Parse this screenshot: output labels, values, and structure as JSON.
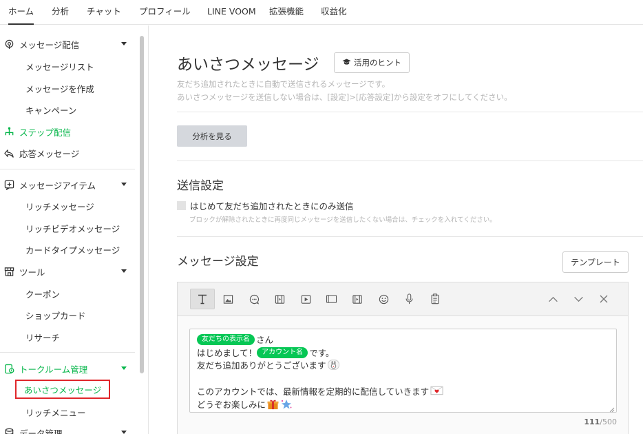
{
  "topnav": {
    "tabs": [
      {
        "label": "ホーム",
        "active": true
      },
      {
        "label": "分析",
        "active": false
      },
      {
        "label": "チャット",
        "active": false
      },
      {
        "label": "プロフィール",
        "active": false
      },
      {
        "label": "LINE VOOM",
        "active": false
      },
      {
        "label": "拡張機能",
        "active": false
      },
      {
        "label": "収益化",
        "active": false
      }
    ]
  },
  "sidebar": {
    "message_delivery": {
      "label": "メッセージ配信",
      "icon": "broadcast-icon"
    },
    "message_list": {
      "label": "メッセージリスト"
    },
    "create_message": {
      "label": "メッセージを作成"
    },
    "campaign": {
      "label": "キャンペーン"
    },
    "step_delivery": {
      "label": "ステップ配信",
      "icon": "step-flow-icon"
    },
    "auto_reply": {
      "label": "応答メッセージ",
      "icon": "reply-arrow-icon"
    },
    "message_items": {
      "label": "メッセージアイテム",
      "icon": "message-item-icon"
    },
    "rich_message": {
      "label": "リッチメッセージ"
    },
    "rich_video_message": {
      "label": "リッチビデオメッセージ"
    },
    "card_message": {
      "label": "カードタイプメッセージ"
    },
    "tools": {
      "label": "ツール",
      "icon": "shop-icon"
    },
    "coupon": {
      "label": "クーポン"
    },
    "shop_card": {
      "label": "ショップカード"
    },
    "research": {
      "label": "リサーチ"
    },
    "talk_room": {
      "label": "トークルーム管理",
      "icon": "talk-room-icon"
    },
    "greeting_message": {
      "label": "あいさつメッセージ"
    },
    "rich_menu": {
      "label": "リッチメニュー"
    },
    "data_management": {
      "label": "データ管理",
      "icon": "database-icon"
    }
  },
  "main": {
    "title": "あいさつメッセージ",
    "hint_button": "活用のヒント",
    "desc_line1": "友だち追加されたときに自動で送信されるメッセージです。",
    "desc_line2": "あいさつメッセージを送信しない場合は、[設定]>[応答設定]から設定をオフにしてください。",
    "analysis_button": "分析を見る",
    "send_settings": {
      "title": "送信設定",
      "checkbox_label": "はじめて友だち追加されたときにのみ送信",
      "checkbox_note": "ブロックが解除されたときに再度同じメッセージを送信したくない場合は、チェックを入れてください。",
      "checked": false
    },
    "message_settings": {
      "title": "メッセージ設定",
      "template_button": "テンプレート"
    },
    "editor": {
      "toolbar_icons": [
        "text-icon",
        "image-icon",
        "sticker-icon",
        "coupon-icon",
        "video-icon",
        "rich-message-icon",
        "rich-video-icon",
        "emoji-icon",
        "voice-icon",
        "research-icon",
        "chevron-up-icon",
        "chevron-down-icon",
        "close-icon"
      ],
      "tag_friend_name": "友だちの表示名",
      "after_friend_name": "さん",
      "line2_before": "はじめまして！",
      "tag_account_name": "アカウント名",
      "line2_after": "です。",
      "line3": "友だち追加ありがとうございます",
      "line5": "このアカウントでは、最新情報を定期的に配信していきます",
      "line6": "どうぞお楽しみに",
      "counter_current": "111",
      "counter_max": "/500"
    }
  },
  "colors": {
    "brand_green": "#06c755",
    "active_outline": "#e0262a"
  }
}
